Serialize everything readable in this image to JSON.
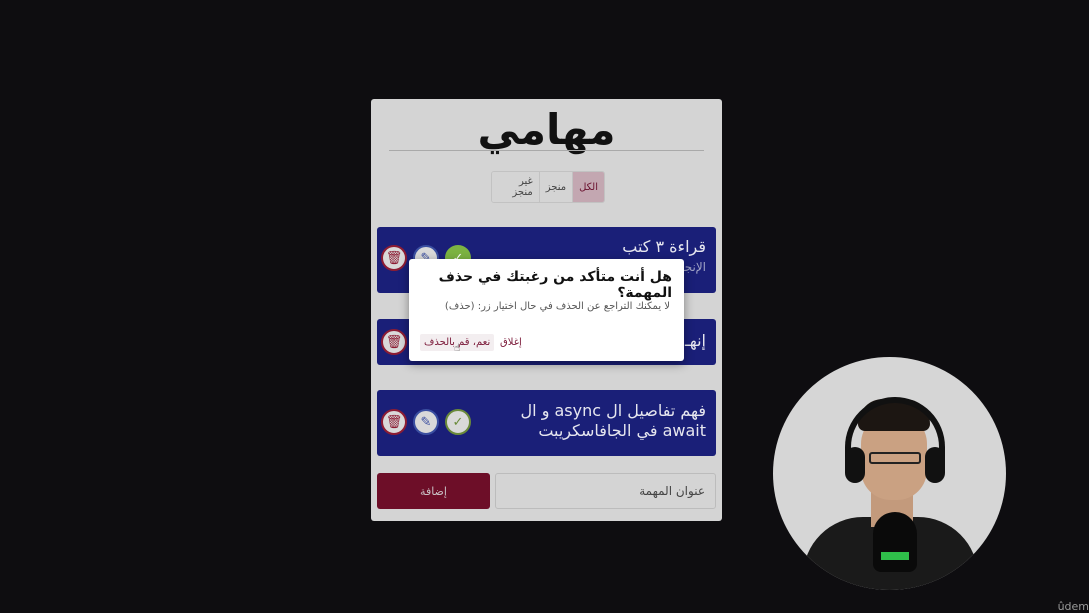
{
  "app": {
    "title": "مهامي",
    "filters": [
      {
        "label": "الكل",
        "active": true
      },
      {
        "label": "منجز",
        "active": false
      },
      {
        "label": "غير منجز",
        "active": false
      }
    ],
    "tasks": [
      {
        "title": "قراءة ٣ كتب",
        "subtitle": "الإنجـ",
        "done": true
      },
      {
        "title": "إنهـ",
        "subtitle": "",
        "done": false
      },
      {
        "title_line1": "فهم تفاصيل ال async و ال",
        "title_line2": "await في الجافاسكريبت",
        "done": false
      }
    ],
    "add_button_label": "إضافة",
    "input_placeholder": "عنوان المهمة"
  },
  "modal": {
    "title": "هل أنت متأكد من رغبتك في حذف المهمة؟",
    "text": "لا يمكنك التراجع عن الحذف في حال اختيار زر: (حذف)",
    "close_label": "إغلاق",
    "confirm_label": "نعم، قم بالحذف"
  },
  "icons": {
    "delete": "trash-icon",
    "edit": "pencil-icon",
    "done": "check-icon"
  },
  "colors": {
    "task_bg": "#1a1f78",
    "accent": "#6d0e28",
    "done_green": "#7cb342"
  },
  "watermark": "ûdem"
}
